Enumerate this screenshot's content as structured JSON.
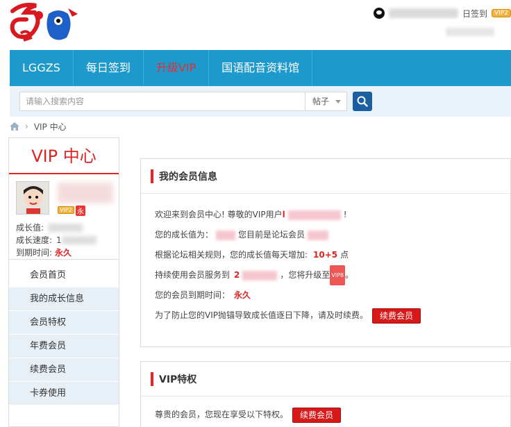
{
  "topbar": {
    "checkin_label": "日签到",
    "vip_badge": "VIP2"
  },
  "nav": {
    "items": [
      {
        "label": "LGGZS"
      },
      {
        "label": "每日签到"
      },
      {
        "label": "升级VIP"
      },
      {
        "label": "国语配音资料馆"
      }
    ]
  },
  "search": {
    "placeholder": "请输入搜索内容",
    "type_value": "帖子"
  },
  "breadcrumb": {
    "current": "VIP 中心"
  },
  "sidebar": {
    "title": "VIP 中心",
    "badge_vip": "VIP2",
    "badge_permanent": "永",
    "growth_label": "成长值:",
    "speed_label": "成长速度:",
    "speed_value_start": "1",
    "expire_label": "到期时间:",
    "expire_value": "永久",
    "menu": [
      {
        "label": "会员首页"
      },
      {
        "label": "我的成长信息"
      },
      {
        "label": "会员特权"
      },
      {
        "label": "年费会员"
      },
      {
        "label": "续费会员"
      },
      {
        "label": "卡券使用"
      }
    ]
  },
  "panel_info": {
    "title": "我的会员信息",
    "welcome_prefix": "欢迎来到会员中心! 尊敬的VIP用户 ",
    "welcome_initial": "l",
    "welcome_suffix": "!",
    "growth_prefix": "您的成长值为：",
    "growth_suffix": "您目前是论坛会员",
    "rule_prefix": "根据论坛相关规则，您的成长值每天增加:",
    "rule_value": "10+5",
    "rule_unit": "点",
    "continue_prefix": "持续使用会员服务到",
    "continue_initial": "2",
    "continue_suffix": "，您将升级至",
    "vip8_badge": "VIP8",
    "continue_end": "。",
    "expire_prefix": "您的会员到期时间：",
    "expire_value": "永久",
    "renew_note": "为了防止您的VIP抛锚导致成长值逐日下降，请及时续费。",
    "renew_button": "续费会员"
  },
  "panel_priv": {
    "title": "VIP特权",
    "text": "尊贵的会员，您现在享受以下特权。",
    "renew_button": "续费会员"
  }
}
